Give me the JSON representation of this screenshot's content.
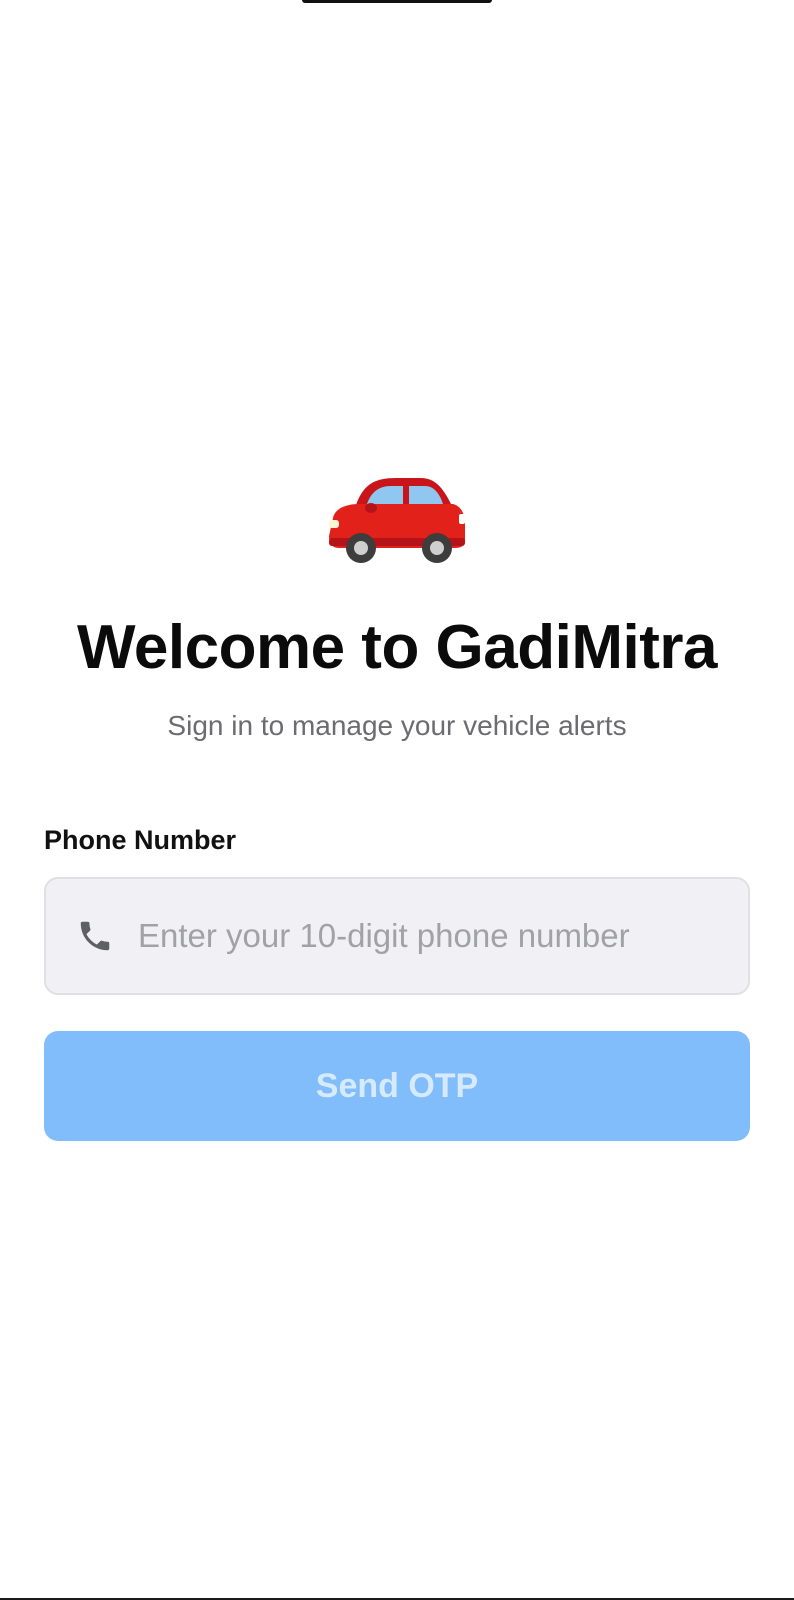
{
  "header": {
    "logo_icon": "red-car-icon",
    "title": "Welcome to GadiMitra",
    "subtitle": "Sign in to manage your vehicle alerts"
  },
  "form": {
    "phone_label": "Phone Number",
    "phone_icon": "phone-icon",
    "phone_value": "",
    "phone_placeholder": "Enter your 10-digit phone number",
    "submit_label": "Send OTP"
  },
  "colors": {
    "button_bg": "#82bdfb",
    "button_text": "#d6eafe",
    "input_bg": "#f1f1f5",
    "car_body": "#e3211b"
  }
}
